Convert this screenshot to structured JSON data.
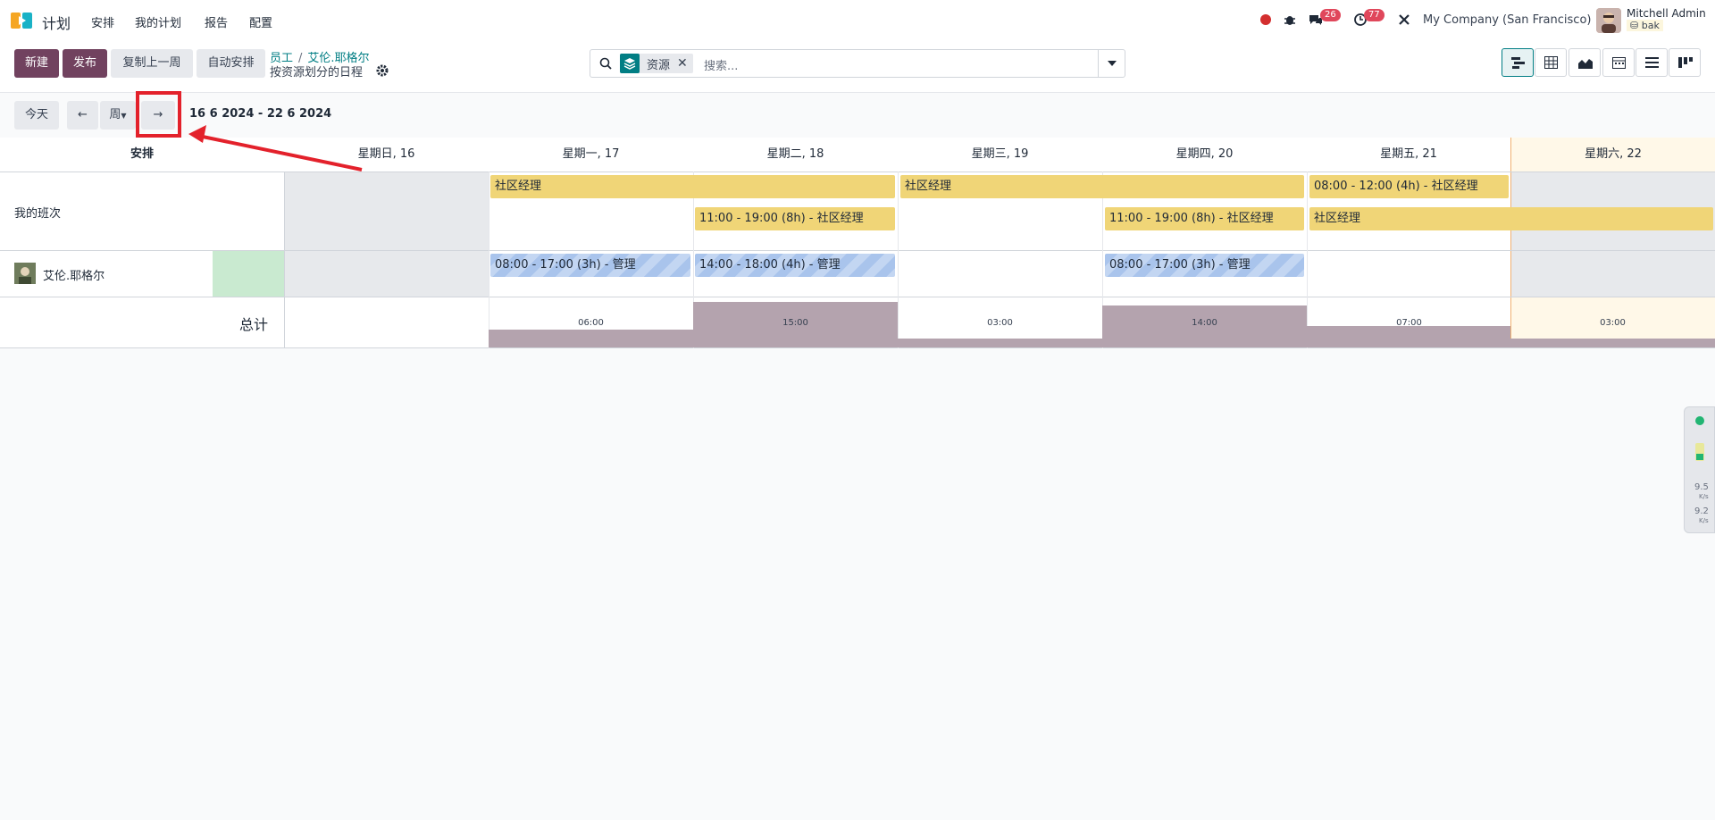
{
  "navbar": {
    "app_name": "计划",
    "menu": [
      "安排",
      "我的计划",
      "报告",
      "配置"
    ],
    "messages_count": "26",
    "activities_count": "77",
    "company": "My Company (San Francisco)",
    "user_name": "Mitchell Admin",
    "user_db": "bak"
  },
  "controlpanel": {
    "new_label": "新建",
    "publish_label": "发布",
    "copy_prev_week_label": "复制上一周",
    "auto_plan_label": "自动安排",
    "breadcrumb": [
      "员工",
      "艾伦.耶格尔"
    ],
    "subtitle": "按资源划分的日程",
    "search_facet": "资源",
    "search_placeholder": "搜索..."
  },
  "navigation": {
    "today_label": "今天",
    "prev_label": "←",
    "scale_label": "周",
    "next_label": "→",
    "date_range": "16 6 2024 - 22 6 2024"
  },
  "gantt": {
    "header_title": "安排",
    "days": [
      "星期日, 16",
      "星期一, 17",
      "星期二, 18",
      "星期三, 19",
      "星期四, 20",
      "星期五, 21",
      "星期六, 22"
    ],
    "rows": [
      {
        "title": "我的班次",
        "pills": [
          "社区经理",
          "11:00 - 19:00 (8h) - 社区经理",
          "社区经理",
          "11:00 - 19:00 (8h) - 社区经理",
          "08:00 - 12:00 (4h) - 社区经理",
          "社区经理"
        ]
      },
      {
        "title": "艾伦.耶格尔",
        "pills": [
          "08:00 - 17:00 (3h) - 管理",
          "14:00 - 18:00 (4h) - 管理",
          "08:00 - 17:00 (3h) - 管理"
        ]
      }
    ],
    "total_label": "总计",
    "totals": [
      "06:00",
      "15:00",
      "03:00",
      "14:00",
      "07:00",
      "03:00"
    ]
  },
  "side_widget": {
    "up_value": "9.5",
    "up_unit": "K/s",
    "down_value": "9.2",
    "down_unit": "K/s"
  },
  "colors": {
    "primary": "#71425f",
    "accent": "#017e84",
    "shift_yellow": "#f0d577",
    "shift_blue": "#a9c4ec",
    "annotation_red": "#e3212b"
  }
}
